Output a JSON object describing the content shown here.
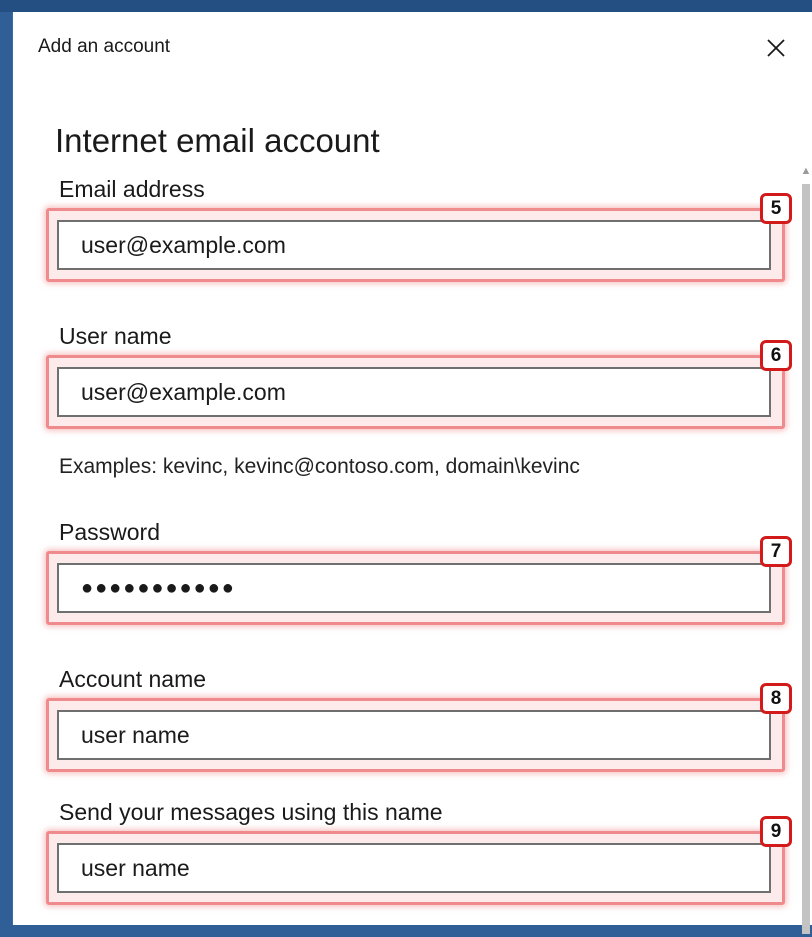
{
  "window": {
    "title": "Add an account",
    "close_glyph": "✕"
  },
  "heading": "Internet email account",
  "fields": {
    "email": {
      "label": "Email address",
      "value": "user@example.com",
      "badge": "5"
    },
    "username": {
      "label": "User name",
      "value": "user@example.com",
      "badge": "6"
    },
    "username_hint": "Examples: kevinc, kevinc@contoso.com, domain\\kevinc",
    "password": {
      "label": "Password",
      "value": "●●●●●●●●●●●",
      "badge": "7"
    },
    "account_name": {
      "label": "Account name",
      "value": "user name",
      "badge": "8"
    },
    "send_name": {
      "label": "Send your messages using this name",
      "value": "user name",
      "badge": "9"
    }
  },
  "scrollbar": {
    "up_glyph": "▲"
  },
  "colors": {
    "accent_desktop": "#2f5f96",
    "highlight_border": "#ef8a8d",
    "badge_border": "#d21a1a"
  },
  "icons": {
    "close": "close-icon",
    "scroll_up": "chevron-up-icon"
  }
}
